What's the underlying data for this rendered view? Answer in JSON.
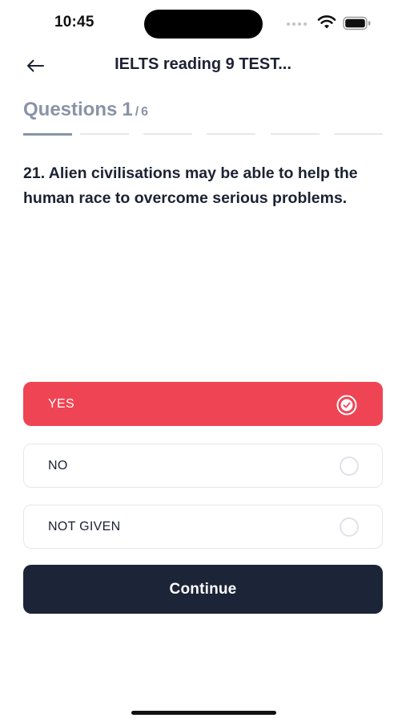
{
  "status_bar": {
    "time": "10:45",
    "icons": [
      "signal-dots-icon",
      "wifi-icon",
      "battery-icon"
    ]
  },
  "header": {
    "back_icon": "arrow-left-icon",
    "title": "IELTS reading 9 TEST..."
  },
  "progress": {
    "label": "Questions",
    "current": "1",
    "separator": "/",
    "total": "6",
    "current_step": 1,
    "total_steps": 6
  },
  "question": {
    "text": "21. Alien civilisations may be able to help the human race to overcome serious problems."
  },
  "options": [
    {
      "label": "YES",
      "selected": true
    },
    {
      "label": "NO",
      "selected": false
    },
    {
      "label": "NOT GIVEN",
      "selected": false
    }
  ],
  "actions": {
    "continue_label": "Continue"
  },
  "colors": {
    "selected_option": "#ef4454",
    "continue_button": "#1c2437",
    "muted_text": "#8a93a6",
    "primary_text": "#1c2233"
  }
}
